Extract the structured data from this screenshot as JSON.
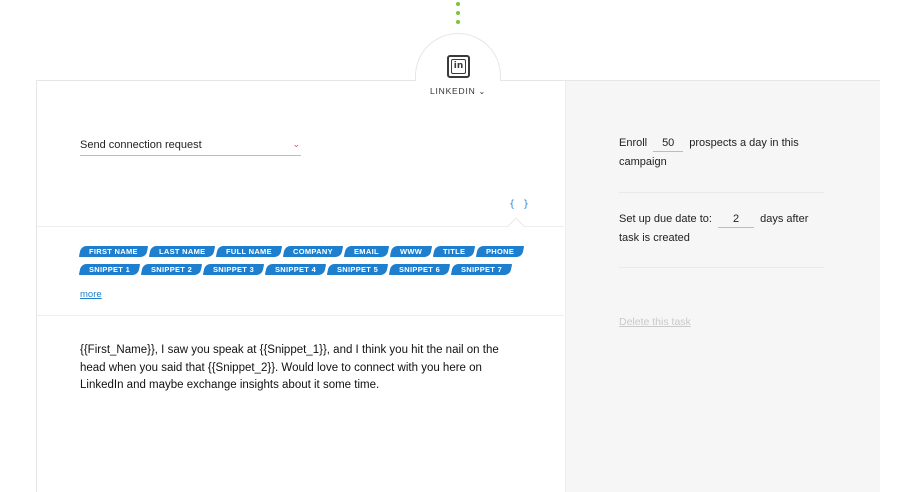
{
  "channel": {
    "name": "LINKEDIN",
    "icon": "linkedin-icon"
  },
  "action": {
    "selected": "Send connection request"
  },
  "variables_button": {
    "label": "{ }"
  },
  "tags": {
    "row1": [
      "FIRST NAME",
      "LAST NAME",
      "FULL NAME",
      "COMPANY",
      "EMAIL",
      "WWW",
      "TITLE",
      "PHONE"
    ],
    "row2": [
      "SNIPPET 1",
      "SNIPPET 2",
      "SNIPPET 3",
      "SNIPPET 4",
      "SNIPPET 5",
      "SNIPPET 6",
      "SNIPPET 7"
    ],
    "more_label": "more"
  },
  "message": {
    "text": "{{First_Name}}, I saw you speak at {{Snippet_1}}, and I think you hit the nail on the head when you said that {{Snippet_2}}. Would love to connect with you here on LinkedIn and maybe exchange insights about it some time."
  },
  "settings": {
    "enroll_prefix": "Enroll",
    "enroll_value": "50",
    "enroll_suffix": "prospects a day in this campaign",
    "due_prefix": "Set up due date to:",
    "due_value": "2",
    "due_suffix": "days after task is created",
    "delete_label": "Delete this task"
  },
  "colors": {
    "accent": "#1e7fcf",
    "connector": "#7ac43a",
    "select_chevron": "#e0486a"
  }
}
